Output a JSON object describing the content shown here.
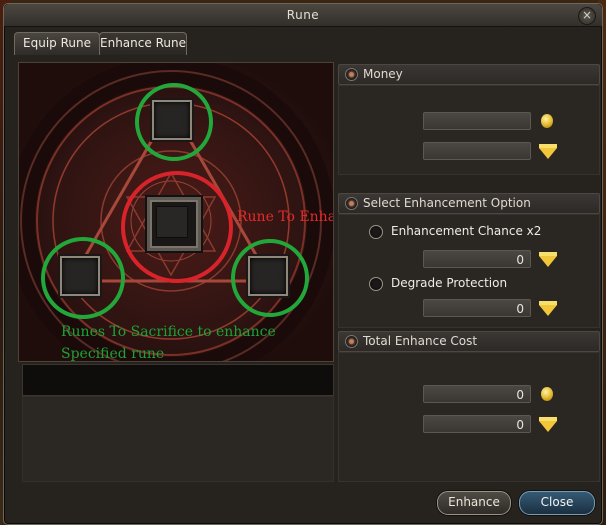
{
  "window": {
    "title": "Rune",
    "close_glyph": "×"
  },
  "tabs": [
    {
      "label": "Equip Rune",
      "active": false
    },
    {
      "label": "Enhance Rune",
      "active": true
    }
  ],
  "annotations": {
    "center": "Rune To Enhance",
    "sacrifice_line1": "Runes To Sacrifice to enhance",
    "sacrifice_line2": "Specified rune"
  },
  "sections": {
    "money": {
      "title": "Money",
      "gold": "",
      "gems": ""
    },
    "enhancement_option": {
      "title": "Select Enhancement Option",
      "option1": {
        "label": "Enhancement Chance x2",
        "value": "0"
      },
      "option2": {
        "label": "Degrade Protection",
        "value": "0"
      }
    },
    "total_cost": {
      "title": "Total Enhance Cost",
      "gold": "0",
      "gems": "0"
    }
  },
  "buttons": {
    "enhance": "Enhance",
    "close": "Close"
  },
  "colors": {
    "green_ring": "#22a83a",
    "red_ring": "#d8232b",
    "close_button": "#355a74"
  },
  "icons": {
    "gold": "coin-icon",
    "gems": "gem-icon"
  }
}
